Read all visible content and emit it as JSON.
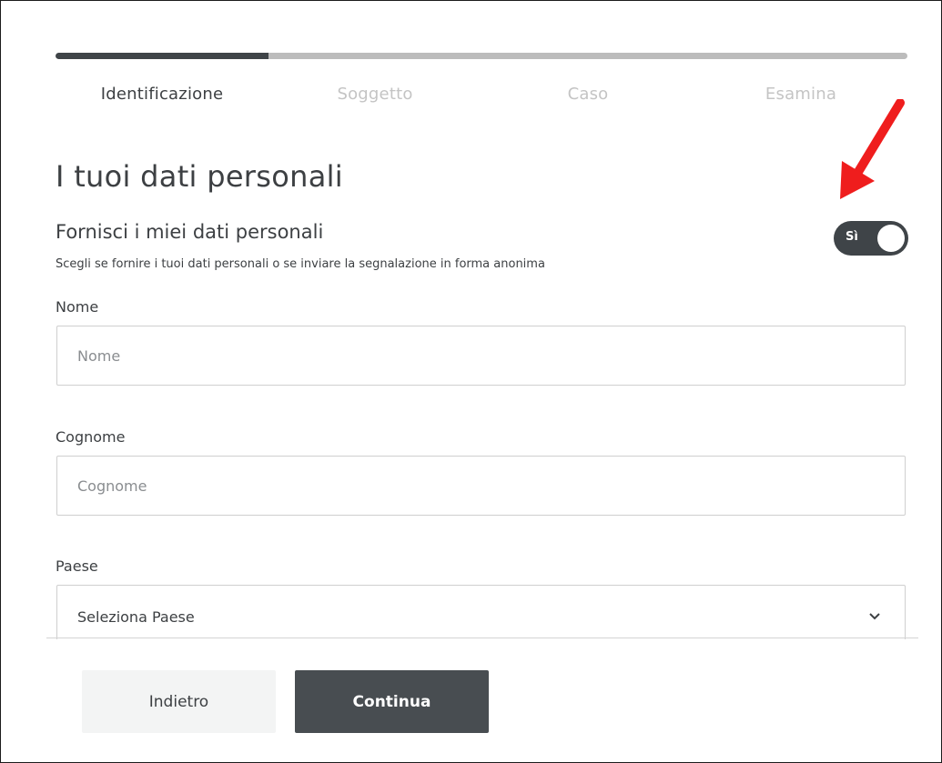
{
  "progress": {
    "fraction": 0.25
  },
  "steps": [
    {
      "label": "Identificazione",
      "active": true
    },
    {
      "label": "Soggetto",
      "active": false
    },
    {
      "label": "Caso",
      "active": false
    },
    {
      "label": "Esamina",
      "active": false
    }
  ],
  "page_title": "I tuoi dati personali",
  "personal_data": {
    "title": "Fornisci i miei dati personali",
    "hint": "Scegli se fornire i tuoi dati personali o se inviare la segnalazione in forma anonima",
    "toggle_label": "Sì",
    "toggle_on": true
  },
  "fields": {
    "first_name": {
      "label": "Nome",
      "placeholder": "Nome",
      "value": ""
    },
    "last_name": {
      "label": "Cognome",
      "placeholder": "Cognome",
      "value": ""
    },
    "country": {
      "label": "Paese",
      "selected": "Seleziona Paese"
    }
  },
  "buttons": {
    "back": "Indietro",
    "continue": "Continua"
  },
  "colors": {
    "accent": "#3f4448",
    "inactive_step": "#c4c4c4",
    "annotation_arrow": "#ef1d1d"
  },
  "icons": {
    "select_arrow": "chevron-down-icon",
    "annotation": "red-arrow-icon"
  }
}
